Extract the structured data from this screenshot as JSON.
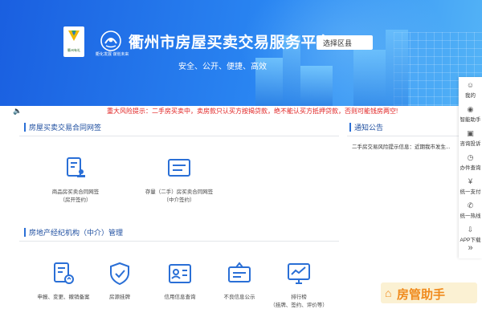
{
  "header": {
    "logo_caption": "衢州有礼",
    "emblem_caption": "衢化发展 谋划未来",
    "title": "衢州市房屋买卖交易服务平台",
    "slogan": "安全、公开、便捷、高效",
    "region_select": "选择区县"
  },
  "right_bar": {
    "items": [
      {
        "label": "我的",
        "icon": "user-icon"
      },
      {
        "label": "智能助手",
        "icon": "chat-icon"
      },
      {
        "label": "咨询投诉",
        "icon": "comment-icon"
      },
      {
        "label": "办件查询",
        "icon": "clock-icon"
      },
      {
        "label": "统一支付",
        "icon": "yen-icon"
      },
      {
        "label": "统一热线",
        "icon": "phone-icon"
      },
      {
        "label": "APP下载",
        "icon": "download-icon"
      },
      {
        "label": "»",
        "icon": "collapse-icon"
      }
    ]
  },
  "warning": {
    "text": "重大风险提示：二手房买卖中，卖房款只认买方按揭贷款，绝不能认买方抵押贷款，否则可能钱房两空!"
  },
  "contract_section": {
    "title": "房屋买卖交易合同网签",
    "tiles": [
      {
        "line1": "商品房买卖合同网签",
        "line2": "（房开签约）",
        "icon": "contract-stamp-icon"
      },
      {
        "line1": "存量（二手）房买卖合同网签",
        "line2": "（中介签约）",
        "icon": "document-icon"
      }
    ]
  },
  "notice": {
    "title": "通知公告",
    "item": "二手房交易风险提示信息：近期我市发生..."
  },
  "agency_section": {
    "title": "房地产经纪机构（中介）管理",
    "tiles": [
      {
        "line1": "申报、变更、撤销备案",
        "line2": "",
        "icon": "file-refresh-icon"
      },
      {
        "line1": "房源挂牌",
        "line2": "",
        "icon": "shield-check-icon"
      },
      {
        "line1": "信用信息查询",
        "line2": "",
        "icon": "id-card-icon"
      },
      {
        "line1": "不良信息公示",
        "line2": "",
        "icon": "bulletin-icon"
      },
      {
        "line1": "排行榜",
        "line2": "（挂牌、签约、评价等）",
        "icon": "chart-monitor-icon"
      }
    ]
  },
  "watermark": {
    "text": "房管助手"
  }
}
